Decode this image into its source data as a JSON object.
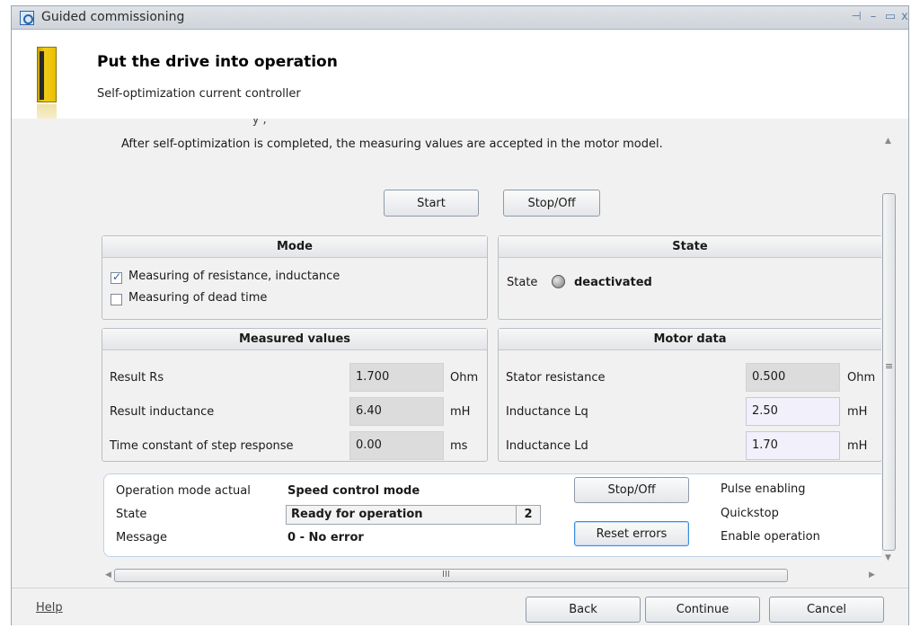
{
  "window": {
    "title": "Guided commissioning",
    "controls": {
      "pin": "⊣",
      "minimize": "–",
      "maximize": "▭",
      "close": "x"
    }
  },
  "header": {
    "title": "Put the drive into operation",
    "subtitle": "Self-optimization current controller",
    "cut_text": "' y ; ' ' '"
  },
  "main": {
    "intro": "After self-optimization is completed, the measuring values are accepted in the motor model.",
    "start_label": "Start",
    "stop_label": "Stop/Off",
    "mode": {
      "title": "Mode",
      "options": [
        {
          "label": "Measuring of resistance, inductance",
          "checked": true
        },
        {
          "label": "Measuring of dead time",
          "checked": false
        }
      ]
    },
    "state": {
      "title": "State",
      "label": "State",
      "value": "deactivated"
    },
    "measured": {
      "title": "Measured values",
      "rows": [
        {
          "label": "Result Rs",
          "value": "1.700",
          "unit": "Ohm"
        },
        {
          "label": "Result inductance",
          "value": "6.40",
          "unit": "mH"
        },
        {
          "label": "Time constant of step response",
          "value": "0.00",
          "unit": "ms"
        }
      ]
    },
    "motor": {
      "title": "Motor data",
      "rows": [
        {
          "label": "Stator resistance",
          "value": "0.500",
          "unit": "Ohm"
        },
        {
          "label": "Inductance Lq",
          "value": "2.50",
          "unit": "mH"
        },
        {
          "label": "Inductance Ld",
          "value": "1.70",
          "unit": "mH"
        }
      ]
    }
  },
  "status": {
    "op_mode_label": "Operation mode actual",
    "op_mode_value": "Speed control mode",
    "state_label": "State",
    "state_value": "Ready for operation",
    "state_count": "2",
    "message_label": "Message",
    "message_value": "0 - No error",
    "stop_label": "Stop/Off",
    "reset_label": "Reset errors",
    "indicators": [
      {
        "label": "Pulse enabling",
        "color": "#c0392b"
      },
      {
        "label": "Quickstop",
        "color": "#1e7a2e"
      },
      {
        "label": "Enable operation",
        "color": "#1e7a2e"
      }
    ]
  },
  "scroll": {
    "grip": "≡",
    "hgrip": "III",
    "up": "▲",
    "down": "▼",
    "left": "◀",
    "right": "▶"
  },
  "footer": {
    "help": "Help",
    "back": "Back",
    "continue": "Continue",
    "cancel": "Cancel"
  }
}
